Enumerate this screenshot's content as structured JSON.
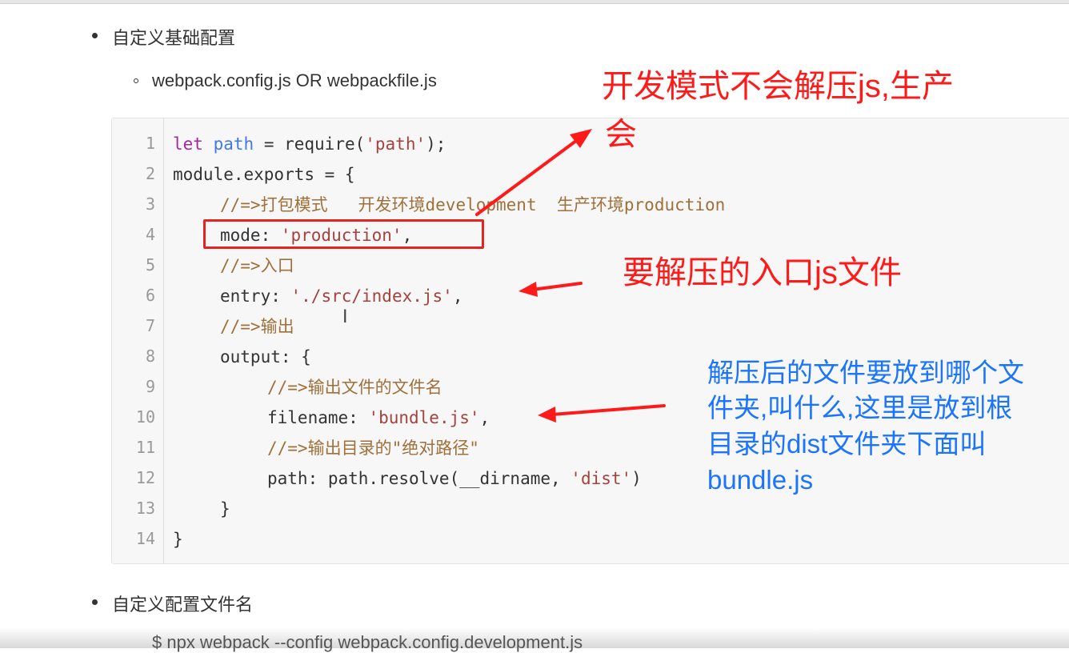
{
  "bullets": {
    "b1": "自定义基础配置",
    "b1_sub": "webpack.config.js OR webpackfile.js",
    "b2": "自定义配置文件名",
    "b2_sub": "$ npx webpack --config webpack.config.development.js"
  },
  "code": {
    "line_numbers": [
      "1",
      "2",
      "3",
      "4",
      "5",
      "6",
      "7",
      "8",
      "9",
      "10",
      "11",
      "12",
      "13",
      "14"
    ],
    "l1": {
      "kw": "let",
      "var": "path",
      "op": " = require(",
      "str": "'path'",
      "end": ");"
    },
    "l2": "module.exports = {",
    "l3": {
      "prefix": "//=>",
      "a": "打包模式   开发环境",
      "b": "development",
      "c": "  生产环境",
      "d": "production"
    },
    "l4": {
      "key": "mode: ",
      "str": "'production'",
      "end": ","
    },
    "l5": {
      "prefix": "//=>",
      "a": "入口"
    },
    "l6": {
      "key": "entry: ",
      "str": "'./src/index.js'",
      "end": ","
    },
    "l7": {
      "prefix": "//=>",
      "a": "输出"
    },
    "l8": "output: {",
    "l9": {
      "prefix": "//=>",
      "a": "输出文件的文件名"
    },
    "l10": {
      "key": "filename: ",
      "str": "'bundle.js'",
      "end": ","
    },
    "l11": {
      "prefix": "//=>",
      "a": "输出目录的\"绝对路径\""
    },
    "l12": {
      "key": "path: path.resolve(__dirname, ",
      "str": "'dist'",
      "end": ")"
    },
    "l13": "}",
    "l14": "}"
  },
  "annotations": {
    "mode_note_1": "开发模式不会解压js,生产",
    "mode_note_2": "会",
    "entry_note": "要解压的入口js文件",
    "output_note_1": "解压后的文件要放到哪个文",
    "output_note_2": "件夹,叫什么,这里是放到根",
    "output_note_3": "目录的dist文件夹下面叫",
    "output_note_4": "bundle.js"
  },
  "colors": {
    "annotation_red": "#ff1a1a",
    "annotation_blue": "#1a74ff",
    "highlight_box": "#e32420"
  }
}
